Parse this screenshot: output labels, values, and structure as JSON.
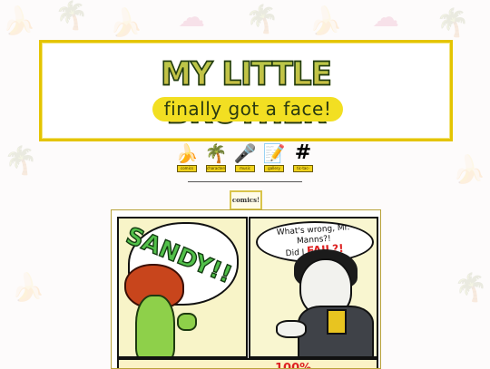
{
  "header": {
    "logo_title": "MY LITTLE BROTHER",
    "tagline": "finally got a face!"
  },
  "nav": {
    "items": [
      {
        "label": "comics",
        "icon": "banana-icon",
        "glyph": "🍌"
      },
      {
        "label": "characters",
        "icon": "palm-tree-icon",
        "glyph": "🌴"
      },
      {
        "label": "music",
        "icon": "microphone-icon",
        "glyph": "🎤"
      },
      {
        "label": "gallery",
        "icon": "notepad-icon",
        "glyph": "📝"
      },
      {
        "label": "tic-tac-toe",
        "icon": "hashtag-icon",
        "glyph": "#"
      }
    ]
  },
  "comics_button": {
    "label": "comics!"
  },
  "comic": {
    "panel1_text": "SANDY!!",
    "panel2_text_line1": "What's wrong, Mr. Manns?!",
    "panel2_text_line2": "Did I",
    "panel2_text_fail": "FAIL?!",
    "panel3_text": "100%"
  },
  "colors": {
    "banner_border": "#e4c400",
    "tagline_bg": "#f2df22",
    "sandy_green": "#52c04a",
    "fail_red": "#d22222"
  }
}
